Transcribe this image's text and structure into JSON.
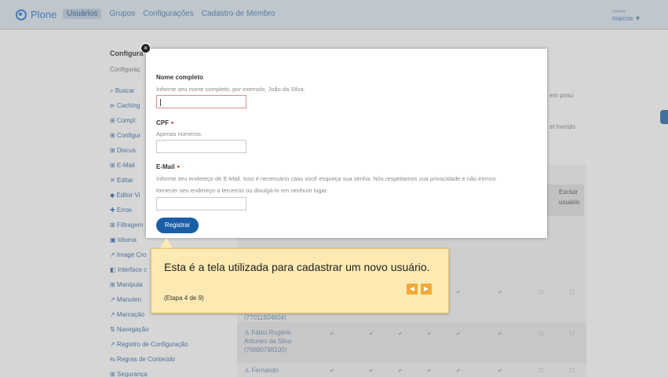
{
  "topbar": {
    "logo": "Plone",
    "nav": [
      "Usuários",
      "Grupos",
      "Configurações",
      "Cadastro de Membro"
    ],
    "user_caption": "Usuário",
    "user_name": "marcos ▼"
  },
  "panel": {
    "title": "Configura",
    "subtitle": "Configuraç",
    "items": [
      "⌕ Buscar",
      "⊳ Caching",
      "⊞ Compl",
      "⊞ Configur",
      "⊞ Discus",
      "⊞ E-Mail",
      "✕ Editar",
      "◆ Editor Vi",
      "✚ Erros",
      "⊞ Filtragem",
      "▣ Idioma",
      "↗ Image Cro",
      "◧ Interface c",
      "⊞ Manipula",
      "↗ Manuten",
      "↗ Marcação",
      "⇅ Navegação",
      "↗ Registro de Configuração",
      "⇆ Regras de Conteúdo",
      "⊞ Segurança"
    ]
  },
  "background": {
    "right_text_1": "em posu",
    "right_text_2": "el Inerido",
    "col_heads": [
      "Excluir",
      "usuário"
    ],
    "col_head_left": "r",
    "users": [
      {
        "name": "(77011504604)"
      },
      {
        "name": "♙ Fábio Rogério"
      },
      {
        "name": "Antunes da Silva"
      },
      {
        "name": "(76690798100)"
      },
      {
        "name": "♙ Fernando"
      }
    ]
  },
  "modal": {
    "close": "×",
    "fields": [
      {
        "label": "Nome completo",
        "required": false,
        "help": "Informe seu nome completo, por exemplo, João da Silva."
      },
      {
        "label": "CPF",
        "required": true,
        "help": "Apenas números."
      },
      {
        "label": "E-Mail",
        "required": true,
        "help": "Informe seu endereço de E-Mail. Isso é necessário caso você esqueça sua senha. Nós respeitamos sua privacidade e não iremos fornecer seu endereço a terceiros ou divulgá-lo em nenhum lugar."
      }
    ],
    "required_mark": "•",
    "submit": "Registrar"
  },
  "tour": {
    "text": "Esta é a tela utilizada para cadastrar um novo usuário.",
    "step": "(Etapa 4 de 9)",
    "prev": "◀",
    "next": "▶"
  },
  "colors": {
    "accent": "#1a5ea8",
    "tour_bg": "#fdeab2",
    "tour_btn": "#f0a93b",
    "required": "#d02020"
  }
}
